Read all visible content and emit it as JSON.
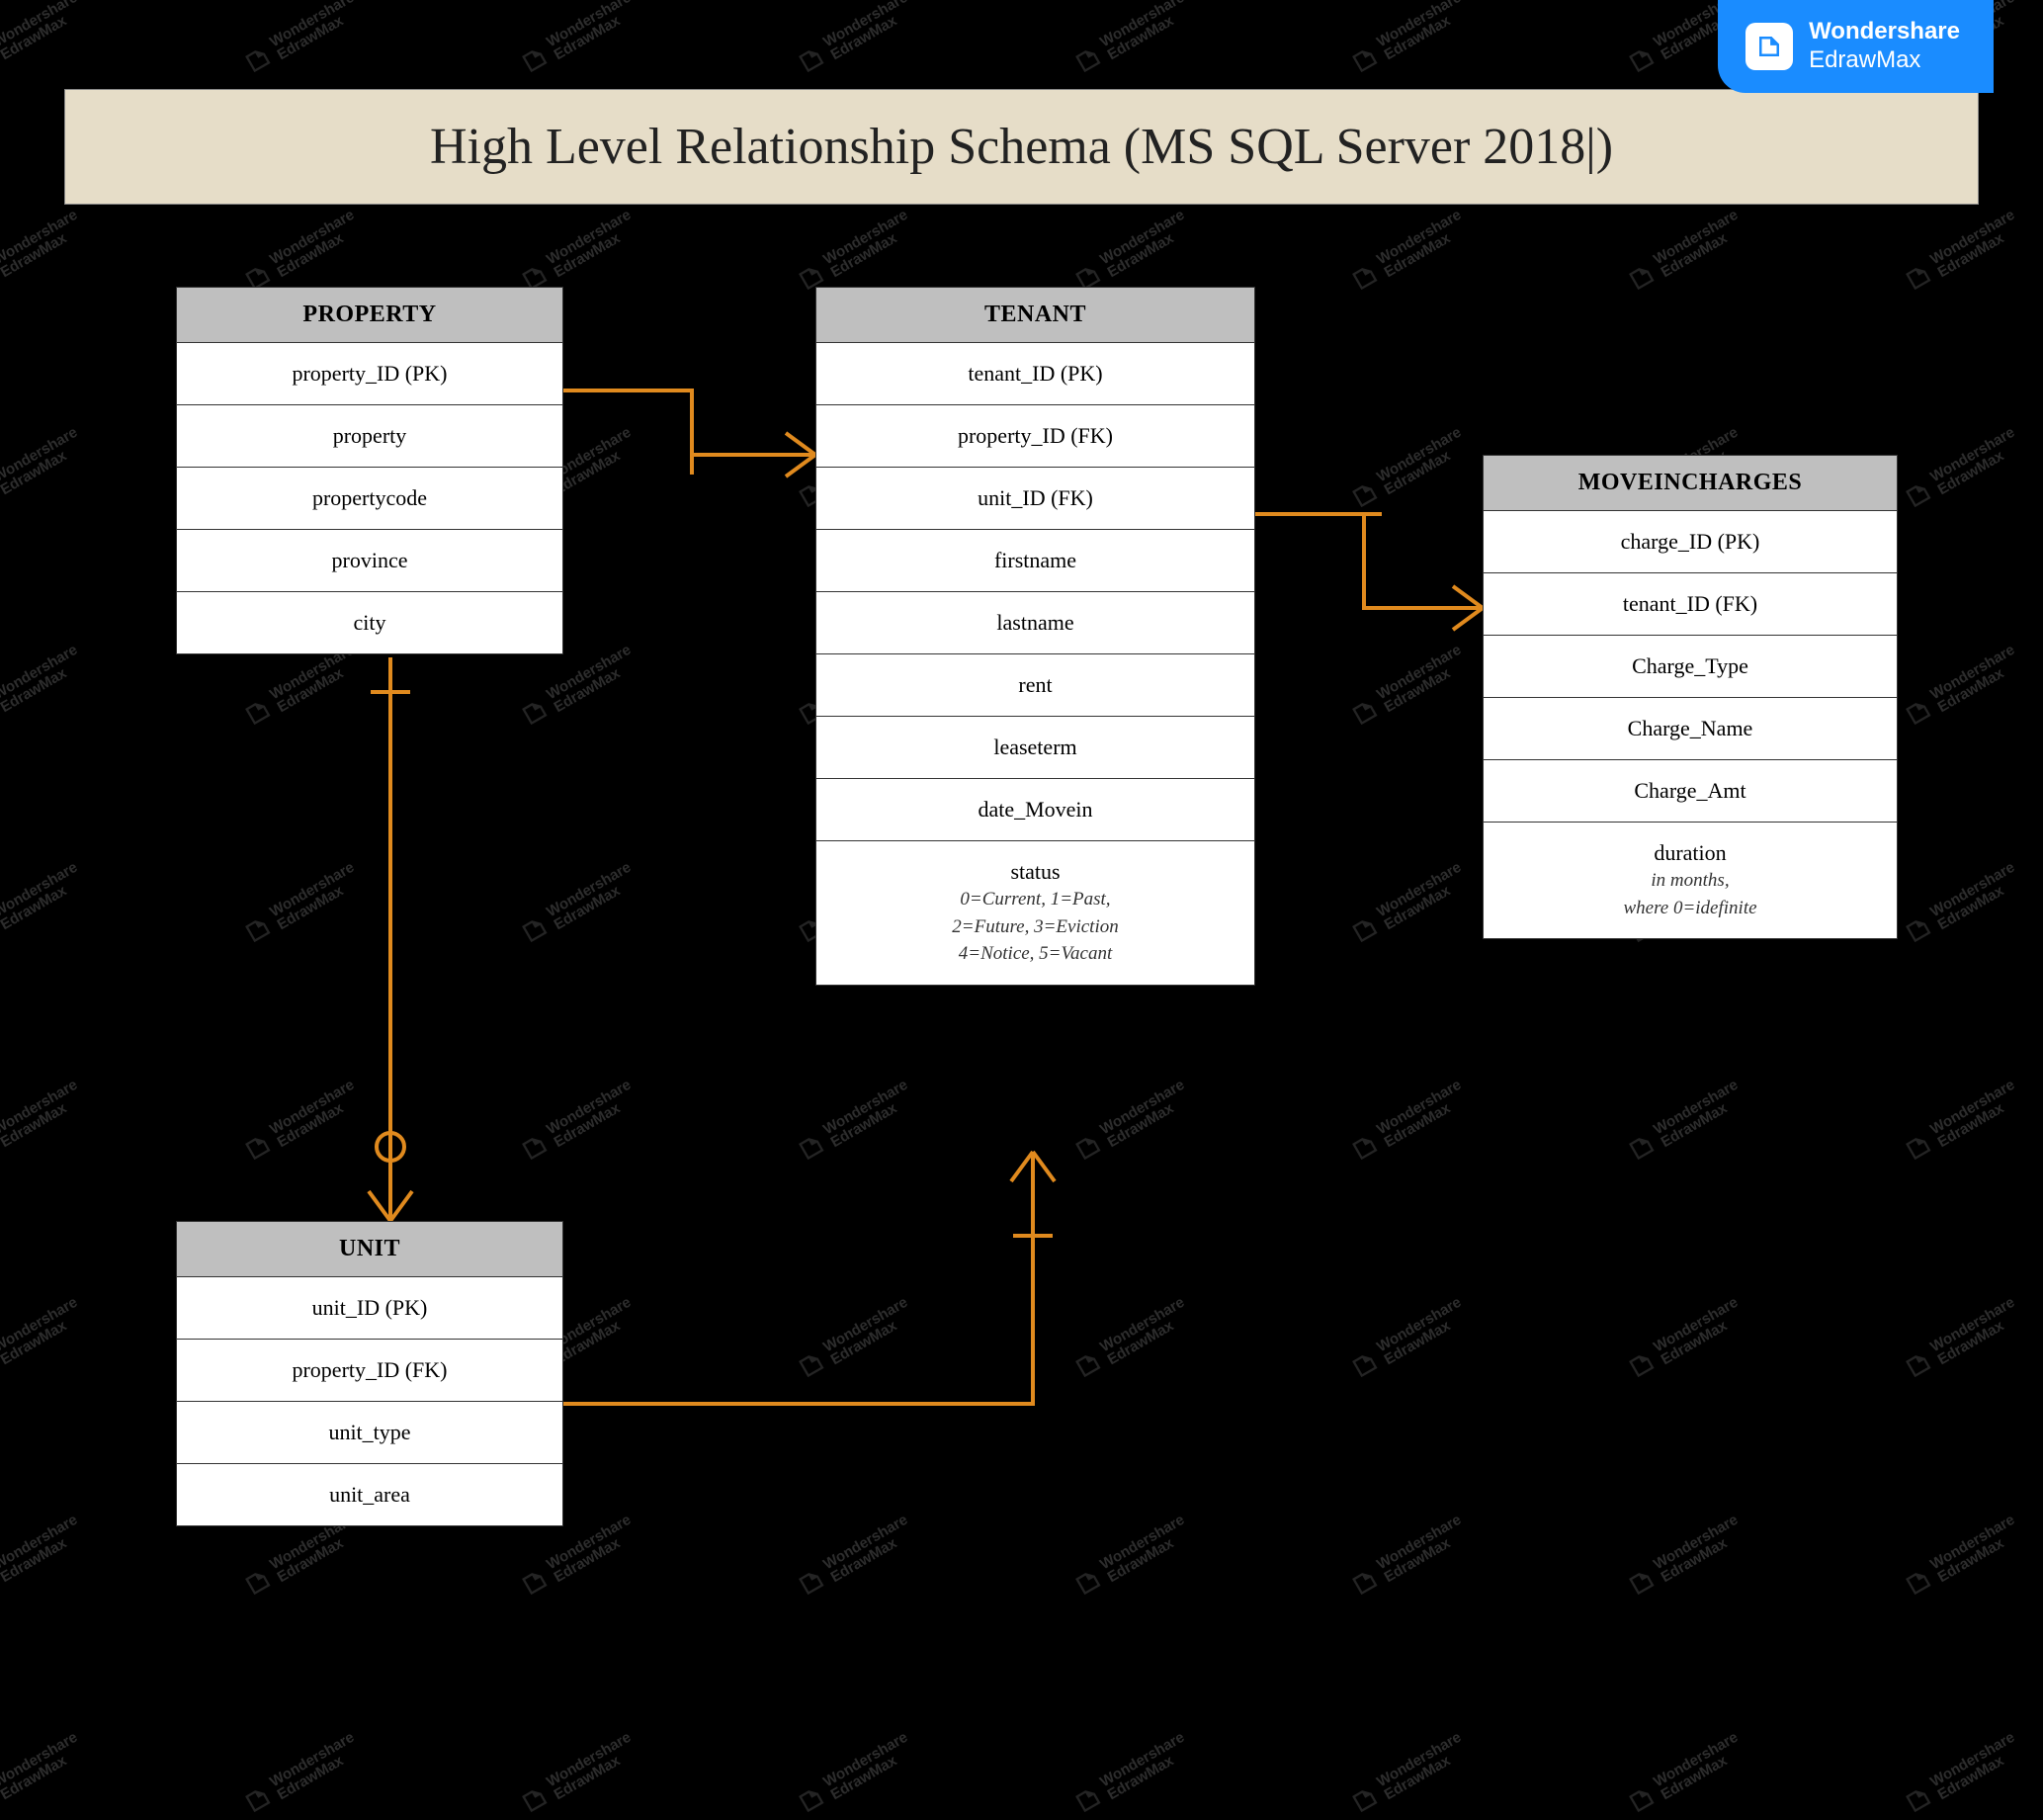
{
  "badge": {
    "line1": "Wondershare",
    "line2": "EdrawMax"
  },
  "watermark_text": "Wondershare EdrawMax",
  "title": "High Level Relationship Schema (MS SQL Server 2018|)",
  "entities": {
    "property": {
      "name": "PROPERTY",
      "attrs": [
        "property_ID (PK)",
        "property",
        "propertycode",
        "province",
        "city"
      ]
    },
    "tenant": {
      "name": "TENANT",
      "attrs": [
        "tenant_ID (PK)",
        "property_ID (FK)",
        "unit_ID (FK)",
        "firstname",
        "lastname",
        "rent",
        "leaseterm",
        "date_Movein"
      ],
      "status_label": "status",
      "status_note1": "0=Current, 1=Past,",
      "status_note2": "2=Future, 3=Eviction",
      "status_note3": "4=Notice, 5=Vacant"
    },
    "moveincharges": {
      "name": "MOVEINCHARGES",
      "attrs": [
        "charge_ID (PK)",
        "tenant_ID (FK)",
        "Charge_Type",
        "Charge_Name",
        "Charge_Amt"
      ],
      "duration_label": "duration",
      "duration_note1": "in months,",
      "duration_note2": "where 0=idefinite"
    },
    "unit": {
      "name": "UNIT",
      "attrs": [
        "unit_ID (PK)",
        "property_ID (FK)",
        "unit_type",
        "unit_area"
      ]
    }
  },
  "relationships": [
    {
      "from": "PROPERTY",
      "to": "TENANT",
      "type": "one-to-many"
    },
    {
      "from": "TENANT",
      "to": "MOVEINCHARGES",
      "type": "one-to-many"
    },
    {
      "from": "PROPERTY",
      "to": "UNIT",
      "type": "one-to-many"
    },
    {
      "from": "UNIT",
      "to": "TENANT",
      "type": "one-to-many"
    }
  ]
}
